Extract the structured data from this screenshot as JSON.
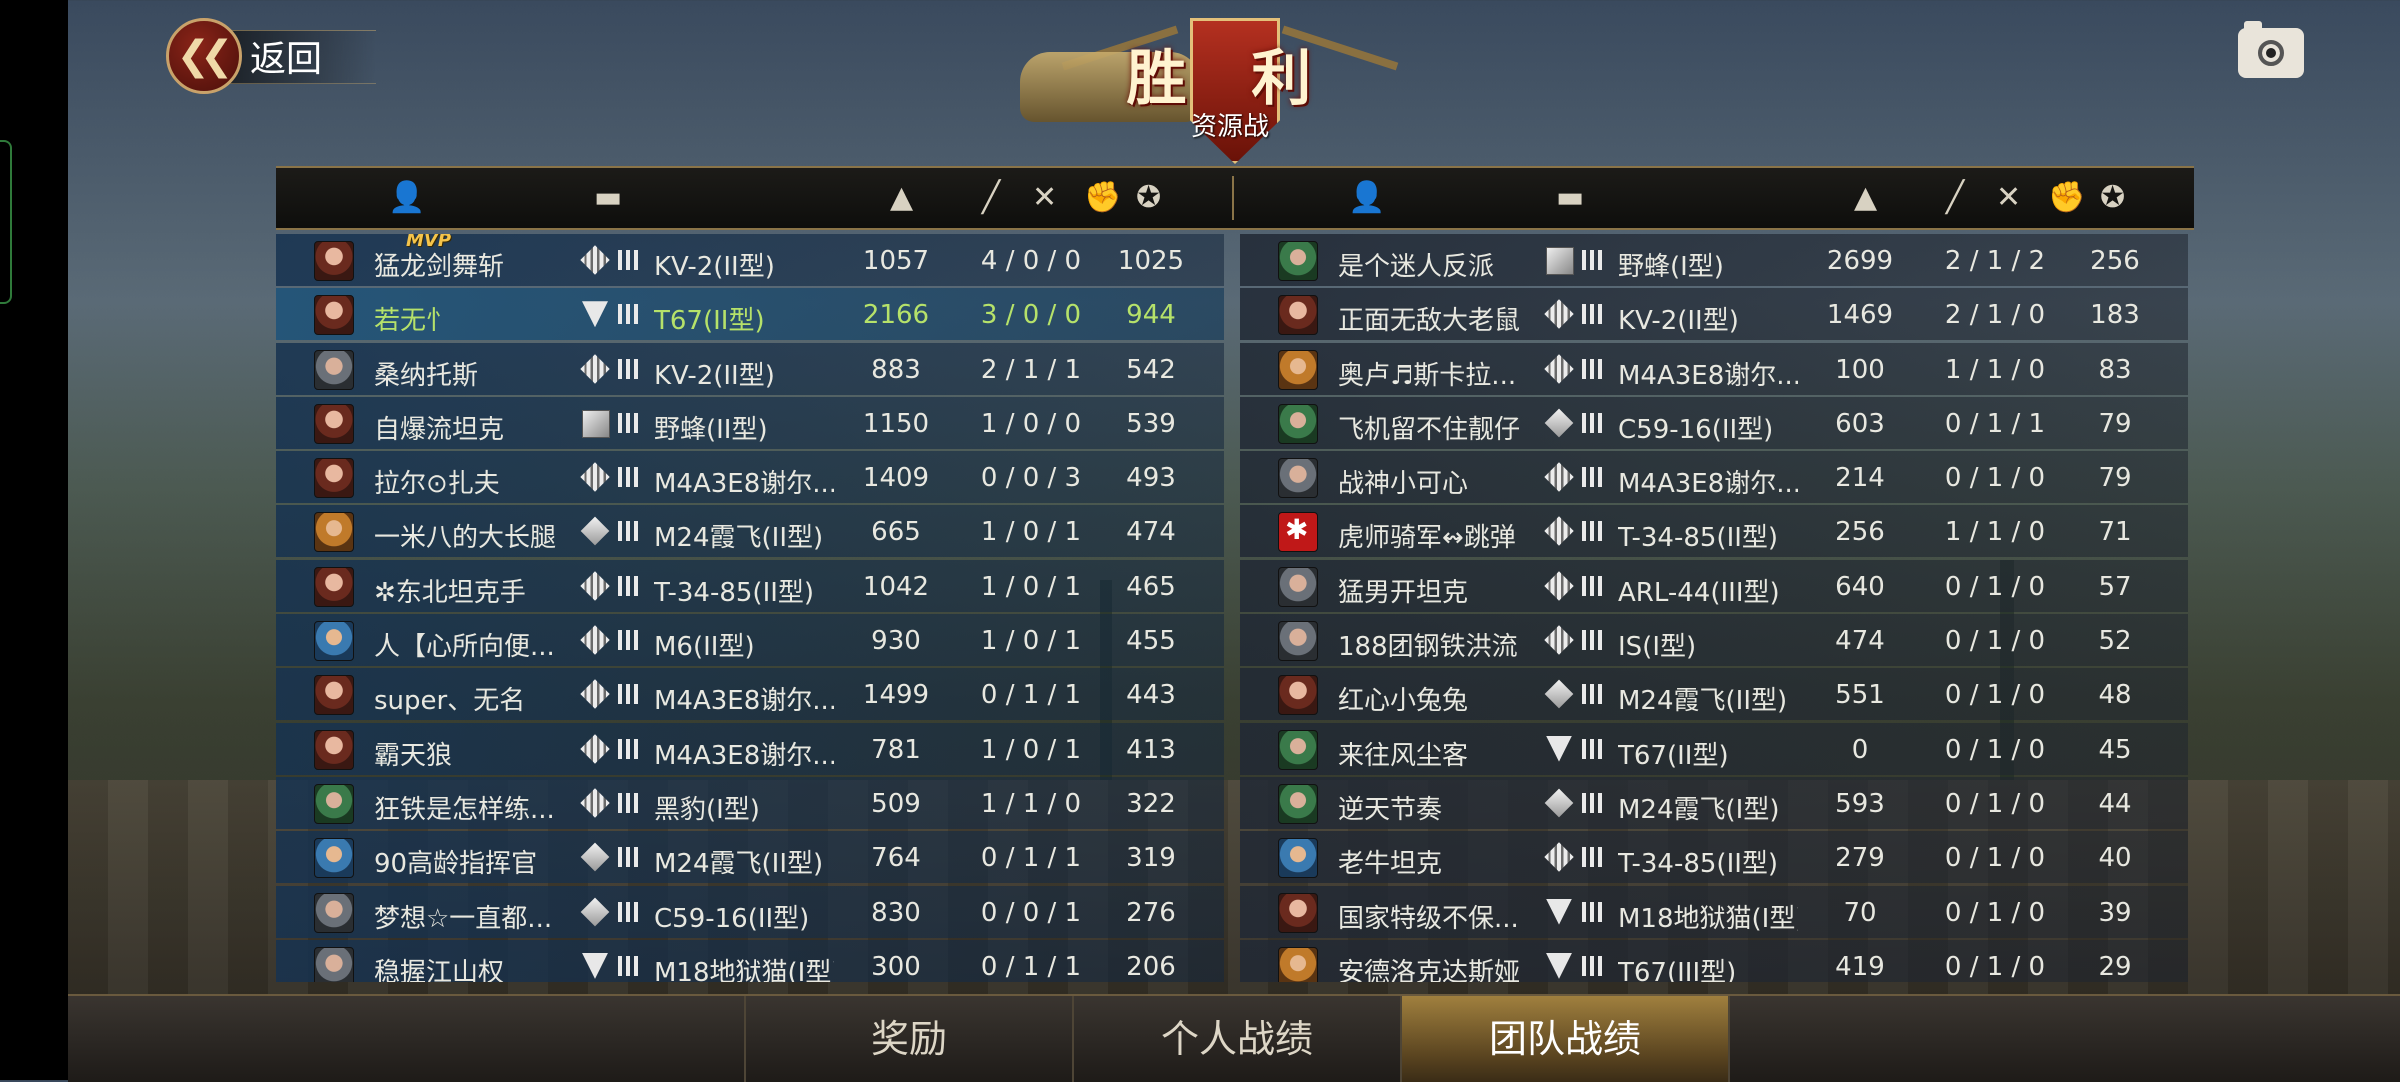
{
  "back": {
    "label": "返回"
  },
  "result": {
    "title": "胜 利",
    "mode": "资源战"
  },
  "header_icons": [
    "player-icon",
    "tank-icon",
    "damage-icon",
    "kills-icon",
    "assists-icon",
    "captures-icon",
    "score-icon"
  ],
  "team_left": [
    {
      "name": "猛龙剑舞斩",
      "mvp": "MVP",
      "avatar": "female",
      "rank": "dd",
      "tank": "KV-2(II型)",
      "damage": "1057",
      "kda": "4 / 0 / 0",
      "score": "1025"
    },
    {
      "name": "若无忄",
      "avatar": "female",
      "rank": "v",
      "tank": "T67(II型)",
      "damage": "2166",
      "kda": "3 / 0 / 0",
      "score": "944",
      "me": true
    },
    {
      "name": "桑纳托斯",
      "avatar": "male",
      "rank": "dd",
      "tank": "KV-2(II型)",
      "damage": "883",
      "kda": "2 / 1 / 1",
      "score": "542"
    },
    {
      "name": "自爆流坦克",
      "avatar": "female",
      "rank": "s",
      "tank": "野蜂(II型)",
      "damage": "1150",
      "kda": "1 / 0 / 0",
      "score": "539"
    },
    {
      "name": "拉尔⊙扎夫",
      "avatar": "female",
      "rank": "dd",
      "tank": "M4A3E8谢尔...",
      "damage": "1409",
      "kda": "0 / 0 / 3",
      "score": "493"
    },
    {
      "name": "一米八的大长腿",
      "avatar": "orange",
      "rank": "d",
      "tank": "M24霞飞(II型)",
      "damage": "665",
      "kda": "1 / 0 / 1",
      "score": "474"
    },
    {
      "name": "✲东北坦克手",
      "avatar": "female",
      "rank": "dd",
      "tank": "T-34-85(II型)",
      "damage": "1042",
      "kda": "1 / 0 / 1",
      "score": "465"
    },
    {
      "name": "人【心所向便...",
      "avatar": "blue",
      "rank": "dd",
      "tank": "M6(II型)",
      "damage": "930",
      "kda": "1 / 0 / 1",
      "score": "455"
    },
    {
      "name": "super、无名",
      "avatar": "female",
      "rank": "dd",
      "tank": "M4A3E8谢尔...",
      "damage": "1499",
      "kda": "0 / 1 / 1",
      "score": "443"
    },
    {
      "name": "霸天狼",
      "avatar": "female",
      "rank": "dd",
      "tank": "M4A3E8谢尔...",
      "damage": "781",
      "kda": "1 / 0 / 1",
      "score": "413"
    },
    {
      "name": "狂铁是怎样练...",
      "avatar": "green",
      "rank": "dd",
      "tank": "黑豹(I型)",
      "damage": "509",
      "kda": "1 / 1 / 0",
      "score": "322"
    },
    {
      "name": "90高龄指挥官",
      "avatar": "blue",
      "rank": "d",
      "tank": "M24霞飞(II型)",
      "damage": "764",
      "kda": "0 / 1 / 1",
      "score": "319"
    },
    {
      "name": "梦想☆一直都...",
      "avatar": "male",
      "rank": "d",
      "tank": "C59-16(II型)",
      "damage": "830",
      "kda": "0 / 0 / 1",
      "score": "276"
    },
    {
      "name": "稳握江山权",
      "avatar": "male",
      "rank": "v",
      "tank": "M18地狱猫(I型)",
      "damage": "300",
      "kda": "0 / 1 / 1",
      "score": "206"
    }
  ],
  "team_right": [
    {
      "name": "是个迷人反派",
      "avatar": "green",
      "rank": "s",
      "tank": "野蜂(I型)",
      "damage": "2699",
      "kda": "2 / 1 / 2",
      "score": "256"
    },
    {
      "name": "正面无敌大老鼠",
      "avatar": "female",
      "rank": "dd",
      "tank": "KV-2(II型)",
      "damage": "1469",
      "kda": "2 / 1 / 0",
      "score": "183"
    },
    {
      "name": "奥卢♬斯卡拉...",
      "avatar": "orange",
      "rank": "dd",
      "tank": "M4A3E8谢尔...",
      "damage": "100",
      "kda": "1 / 1 / 0",
      "score": "83"
    },
    {
      "name": "飞机留不住靓仔",
      "avatar": "green",
      "rank": "d",
      "tank": "C59-16(II型)",
      "damage": "603",
      "kda": "0 / 1 / 1",
      "score": "79"
    },
    {
      "name": "战神小可心",
      "avatar": "male",
      "rank": "dd",
      "tank": "M4A3E8谢尔...",
      "damage": "214",
      "kda": "0 / 1 / 0",
      "score": "79"
    },
    {
      "name": "虎师骑军↭跳弹",
      "avatar": "red",
      "rank": "dd",
      "tank": "T-34-85(II型)",
      "damage": "256",
      "kda": "1 / 1 / 0",
      "score": "71"
    },
    {
      "name": "猛男开坦克",
      "avatar": "male",
      "rank": "dd",
      "tank": "ARL-44(III型)",
      "damage": "640",
      "kda": "0 / 1 / 0",
      "score": "57"
    },
    {
      "name": "188团钢铁洪流",
      "avatar": "male",
      "rank": "dd",
      "tank": "IS(I型)",
      "damage": "474",
      "kda": "0 / 1 / 0",
      "score": "52"
    },
    {
      "name": "红心小兔兔",
      "avatar": "female",
      "rank": "d",
      "tank": "M24霞飞(II型)",
      "damage": "551",
      "kda": "0 / 1 / 0",
      "score": "48"
    },
    {
      "name": "来往风尘客",
      "avatar": "green",
      "rank": "v",
      "tank": "T67(II型)",
      "damage": "0",
      "kda": "0 / 1 / 0",
      "score": "45"
    },
    {
      "name": "逆天节奏",
      "avatar": "green",
      "rank": "d",
      "tank": "M24霞飞(I型)",
      "damage": "593",
      "kda": "0 / 1 / 0",
      "score": "44"
    },
    {
      "name": "老牛坦克",
      "avatar": "blue",
      "rank": "dd",
      "tank": "T-34-85(II型)",
      "damage": "279",
      "kda": "0 / 1 / 0",
      "score": "40"
    },
    {
      "name": "国家特级不保...",
      "avatar": "female",
      "rank": "v",
      "tank": "M18地狱猫(I型)",
      "damage": "70",
      "kda": "0 / 1 / 0",
      "score": "39"
    },
    {
      "name": "安德洛克达斯娅",
      "avatar": "orange",
      "rank": "v",
      "tank": "T67(III型)",
      "damage": "419",
      "kda": "0 / 1 / 0",
      "score": "29"
    }
  ],
  "tabs": [
    {
      "label": "奖励",
      "active": false
    },
    {
      "label": "个人战绩",
      "active": false
    },
    {
      "label": "团队战绩",
      "active": true
    }
  ]
}
